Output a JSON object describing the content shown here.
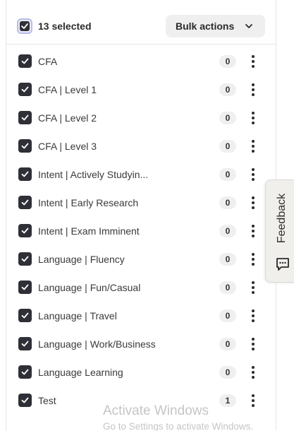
{
  "header": {
    "selected_count": "13 selected",
    "bulk_actions_label": "Bulk actions"
  },
  "tags": [
    {
      "label": "CFA",
      "count": "0",
      "checked": true
    },
    {
      "label": "CFA | Level 1",
      "count": "0",
      "checked": true
    },
    {
      "label": "CFA | Level 2",
      "count": "0",
      "checked": true
    },
    {
      "label": "CFA | Level 3",
      "count": "0",
      "checked": true
    },
    {
      "label": "Intent | Actively Studyin...",
      "count": "0",
      "checked": true
    },
    {
      "label": "Intent | Early Research",
      "count": "0",
      "checked": true
    },
    {
      "label": "Intent | Exam Imminent",
      "count": "0",
      "checked": true
    },
    {
      "label": "Language | Fluency",
      "count": "0",
      "checked": true
    },
    {
      "label": "Language | Fun/Casual",
      "count": "0",
      "checked": true
    },
    {
      "label": "Language | Travel",
      "count": "0",
      "checked": true
    },
    {
      "label": "Language | Work/Business",
      "count": "0",
      "checked": true
    },
    {
      "label": "Language Learning",
      "count": "0",
      "checked": true
    },
    {
      "label": "Test",
      "count": "1",
      "checked": true
    }
  ],
  "feedback": {
    "label": "Feedback",
    "icon": "comment-icon"
  },
  "watermark": {
    "title": "Activate Windows",
    "subtitle": "Go to Settings to activate Windows."
  },
  "icons": {
    "select_all": "checkbox-indeterminate-icon",
    "row_check": "check-icon",
    "bulk_chevron": "chevron-down-icon",
    "row_menu": "more-vertical-icon"
  },
  "colors": {
    "checkbox_fill": "#2f2f37",
    "pill_bg": "#efefef",
    "select_all_ring": "#b7bde8",
    "feedback_bg": "#f1efec"
  }
}
